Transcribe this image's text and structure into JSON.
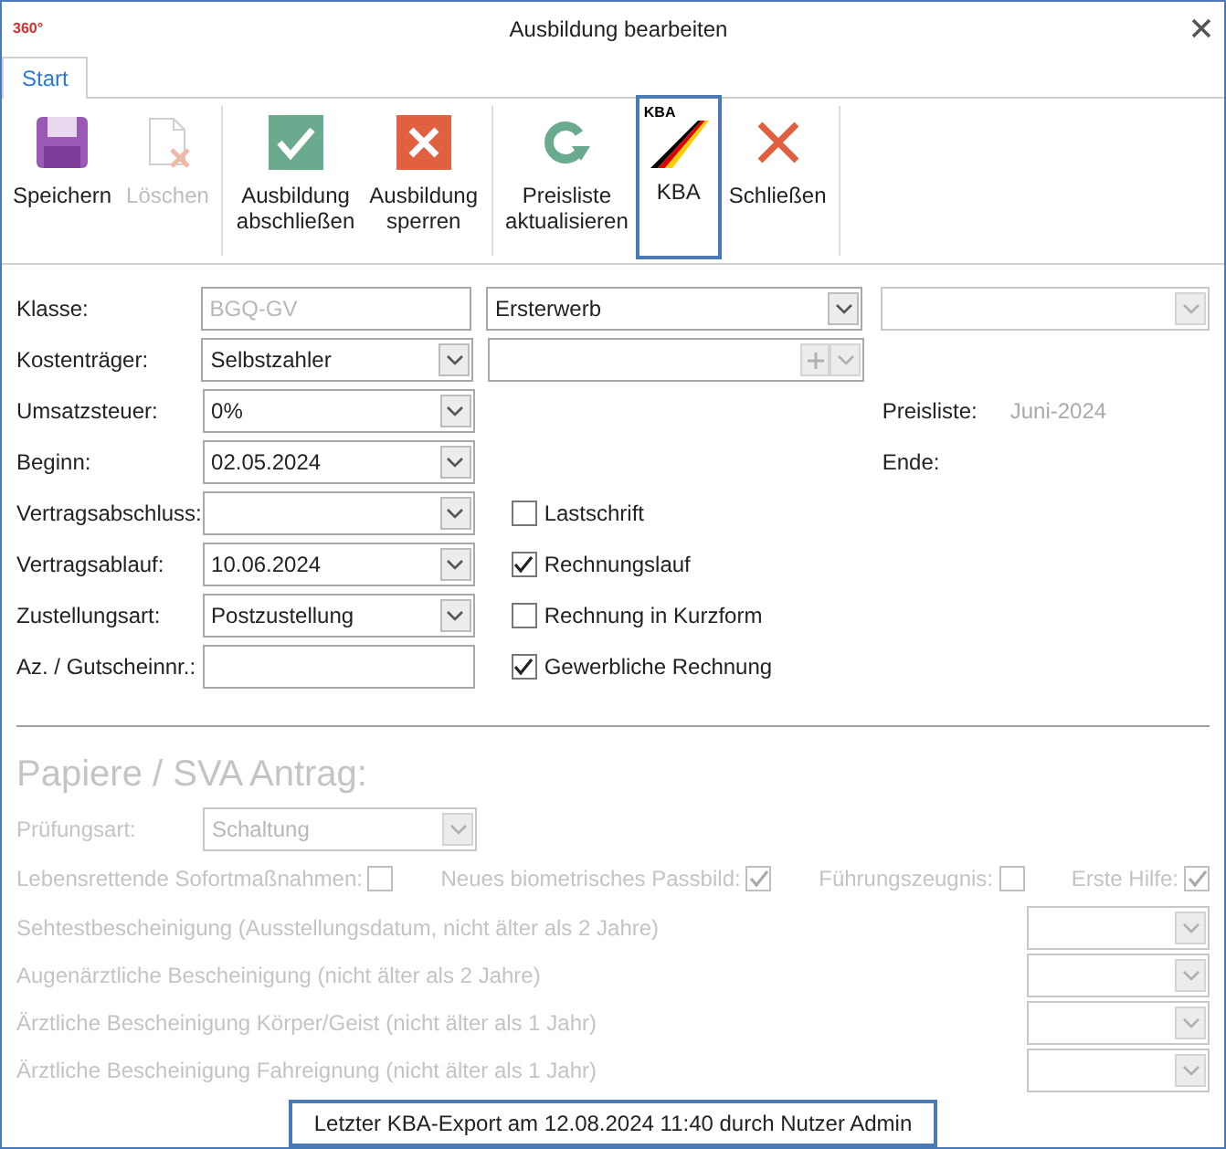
{
  "window": {
    "title": "Ausbildung bearbeiten",
    "logo": "360°"
  },
  "tabs": [
    {
      "label": "Start",
      "selected": true
    }
  ],
  "ribbon": [
    {
      "buttons": [
        {
          "kind": "save",
          "label": "Speichern",
          "disabled": false,
          "selected": false
        },
        {
          "kind": "delete",
          "label": "Löschen",
          "disabled": true,
          "selected": false
        }
      ]
    },
    {
      "buttons": [
        {
          "kind": "check",
          "label": "Ausbildung abschließen",
          "disabled": false,
          "selected": false
        },
        {
          "kind": "block",
          "label": "Ausbildung sperren",
          "disabled": false,
          "selected": false
        }
      ]
    },
    {
      "buttons": [
        {
          "kind": "refresh",
          "label": "Preisliste aktualisieren",
          "disabled": false,
          "selected": false
        },
        {
          "kind": "kba",
          "label": "KBA",
          "badge": "KBA",
          "disabled": false,
          "selected": true
        },
        {
          "kind": "close",
          "label": "Schließen",
          "disabled": false,
          "selected": false
        }
      ]
    }
  ],
  "form_rows": [
    {
      "label": "Klasse:",
      "field": {
        "kind": "text",
        "value": "BGQ-GV",
        "disabled": true
      },
      "middle": {
        "kind": "combo",
        "value": "Ersterwerb"
      },
      "right": {
        "kind": "combo"
      }
    },
    {
      "label": "Kostenträger:",
      "field": {
        "kind": "combo",
        "value": "Selbstzahler"
      },
      "middle": {
        "kind": "combo_add"
      }
    },
    {
      "label": "Umsatzsteuer:",
      "field": {
        "kind": "combo",
        "value": "0%"
      },
      "right": {
        "kind": "info",
        "label": "Preisliste:",
        "value": "Juni-2024"
      }
    },
    {
      "label": "Beginn:",
      "field": {
        "kind": "combo",
        "value": "02.05.2024"
      },
      "right": {
        "kind": "info",
        "label": "Ende:"
      }
    },
    {
      "label": "Vertragsabschluss:",
      "field": {
        "kind": "combo"
      },
      "middle": {
        "kind": "checkbox",
        "label": "Lastschrift",
        "checked": false
      }
    },
    {
      "label": "Vertragsablauf:",
      "field": {
        "kind": "combo",
        "value": "10.06.2024"
      },
      "middle": {
        "kind": "checkbox",
        "label": "Rechnungslauf",
        "checked": true
      }
    },
    {
      "label": "Zustellungsart:",
      "field": {
        "kind": "combo",
        "value": "Postzustellung"
      },
      "middle": {
        "kind": "checkbox",
        "label": "Rechnung in Kurzform",
        "checked": false
      }
    },
    {
      "label": "Az. / Gutscheinnr.:",
      "field": {
        "kind": "text"
      },
      "middle": {
        "kind": "checkbox",
        "label": "Gewerbliche Rechnung",
        "checked": true
      }
    }
  ],
  "papers": {
    "title": "Papiere / SVA Antrag:",
    "disabled": true,
    "exam": {
      "label": "Prüfungsart:",
      "value": "Schaltung"
    },
    "checks": [
      {
        "label": "Lebensrettende Sofortmaßnahmen:",
        "checked": false
      },
      {
        "label": "Neues biometrisches Passbild:",
        "checked": true
      },
      {
        "label": "Führungszeugnis:",
        "checked": false
      },
      {
        "label": "Erste Hilfe:",
        "checked": true
      }
    ],
    "documents": [
      {
        "label": "Sehtestbescheinigung (Ausstellungsdatum, nicht älter als 2 Jahre)"
      },
      {
        "label": "Augenärztliche Bescheinigung (nicht älter als 2 Jahre)"
      },
      {
        "label": "Ärztliche Bescheinigung Körper/Geist (nicht älter als 1 Jahr)"
      },
      {
        "label": "Ärztliche Bescheinigung Fahreignung (nicht älter als 1 Jahr)"
      }
    ]
  },
  "status": "Letzter KBA-Export am 12.08.2024 11:40 durch Nutzer Admin"
}
